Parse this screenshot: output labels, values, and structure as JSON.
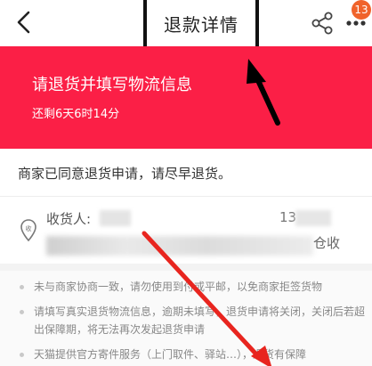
{
  "nav": {
    "title": "退款详情",
    "badge_count": "13",
    "icons": {
      "back": "back-chevron-icon",
      "share": "share-icon",
      "more": "more-icon"
    }
  },
  "banner": {
    "title": "请退货并填写物流信息",
    "remaining": "还剩6天6时14分",
    "color": "#fb1f46"
  },
  "status": {
    "message": "商家已同意退货申请，请尽早退货。"
  },
  "address": {
    "recipient_label": "收货人:",
    "phone_prefix": "13",
    "address_tail": "仓收"
  },
  "tips": [
    "未与商家协商一致，请勿使用到付或平邮，以免商家拒签货物",
    "请填写真实退货物流信息，逾期未填写，退货申请将关闭，关闭后若超出保障期，将无法再次发起退货申请",
    "天猫提供官方寄件服务（上门取件、驿站…），退货有保障"
  ]
}
